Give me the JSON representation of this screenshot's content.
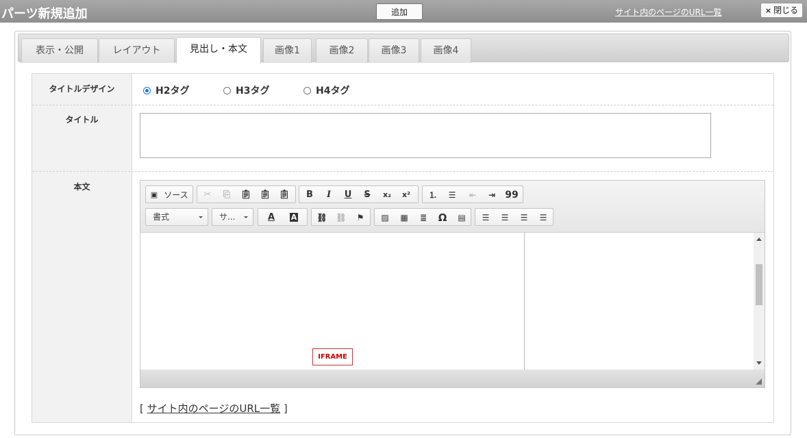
{
  "header": {
    "title": "パーツ新規追加",
    "add_label": "追加",
    "url_list_link": "サイト内のページのURL一覧",
    "close_label": "閉じる",
    "close_icon": "×"
  },
  "tabs": [
    {
      "label": "表示・公開",
      "active": false
    },
    {
      "label": "レイアウト",
      "active": false
    },
    {
      "label": "見出し・本文",
      "active": true
    },
    {
      "label": "画像1",
      "active": false
    },
    {
      "label": "画像2",
      "active": false
    },
    {
      "label": "画像3",
      "active": false
    },
    {
      "label": "画像4",
      "active": false
    }
  ],
  "form": {
    "title_design": {
      "label": "タイトルデザイン",
      "options": [
        "H2タグ",
        "H3タグ",
        "H4タグ"
      ],
      "selected": "H2タグ"
    },
    "title": {
      "label": "タイトル",
      "value": ""
    },
    "body": {
      "label": "本文",
      "toolbar": {
        "source_label": "ソース",
        "format_label": "書式",
        "size_label": "サ...",
        "bold": "B",
        "italic": "I",
        "underline": "U",
        "strike": "S",
        "subscript": "x₂",
        "superscript": "x²",
        "blockquote": "99",
        "special_char": "Ω",
        "text_color": "A",
        "bg_color": "A"
      },
      "iframe_placeholder": "IFRAME"
    },
    "link_open": "[",
    "link_text": "サイト内のページのURL一覧",
    "link_close": "]"
  }
}
